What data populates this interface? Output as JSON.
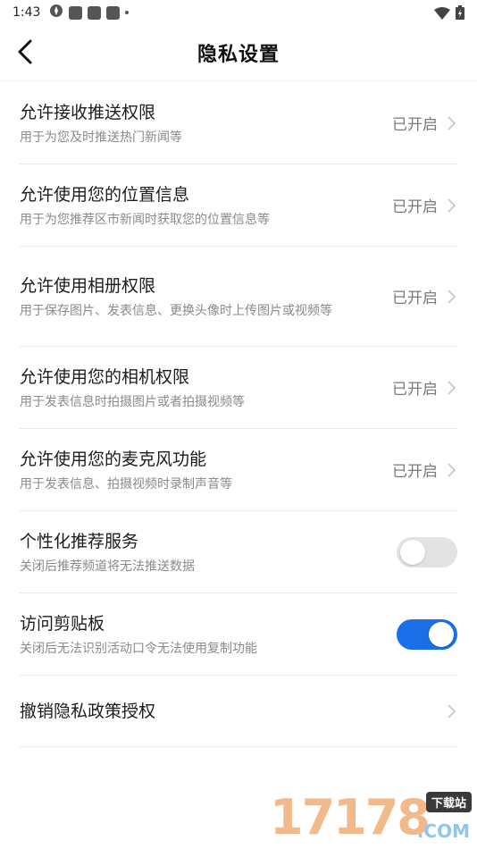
{
  "status_bar": {
    "time": "1:43"
  },
  "header": {
    "title": "隐私设置"
  },
  "settings": [
    {
      "title": "允许接收推送权限",
      "desc": "用于为您及时推送热门新闻等",
      "status": "已开启"
    },
    {
      "title": "允许使用您的位置信息",
      "desc": "用于为您推荐区市新闻时获取您的位置信息等",
      "status": "已开启"
    },
    {
      "title": "允许使用相册权限",
      "desc": "用于保存图片、发表信息、更换头像时上传图片或视频等",
      "status": "已开启"
    },
    {
      "title": "允许使用您的相机权限",
      "desc": "用于发表信息时拍摄图片或者拍摄视频等",
      "status": "已开启"
    },
    {
      "title": "允许使用您的麦克风功能",
      "desc": "用于发表信息、拍摄视频时录制声音等",
      "status": "已开启"
    }
  ],
  "toggles": [
    {
      "title": "个性化推荐服务",
      "desc": "关闭后推荐频道将无法推送数据",
      "state": "off"
    },
    {
      "title": "访问剪贴板",
      "desc": "关闭后无法识别活动口令无法使用复制功能",
      "state": "on"
    }
  ],
  "revoke": {
    "title": "撤销隐私政策授权"
  },
  "watermark": {
    "digits": "17178",
    "tag": "下载站",
    "com": ".COM"
  },
  "colors": {
    "accent": "#1a6fe8",
    "toggle_off": "#e3e3e3"
  }
}
